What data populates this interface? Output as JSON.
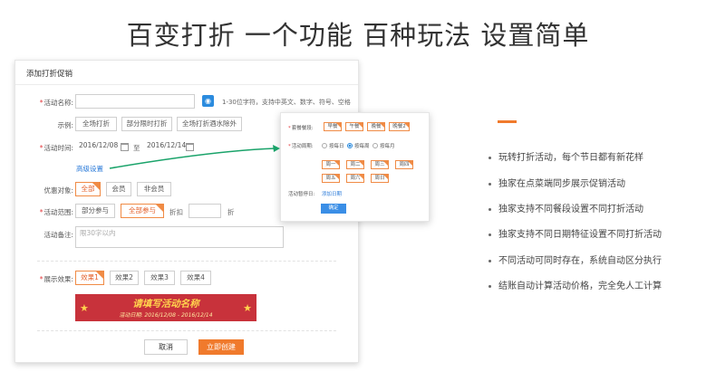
{
  "headline": "百变打折 一个功能 百种玩法 设置简单",
  "form": {
    "title": "添加打折促销",
    "activity_name": {
      "label": "活动名称:",
      "placeholder": "",
      "hint": "1-30位字符，支持中英文、数字、符号、空格"
    },
    "example": {
      "label": "示例:",
      "options": [
        "全场打折",
        "部分限时打折",
        "全场打折酒水除外"
      ]
    },
    "activity_time": {
      "label": "活动时间:",
      "start": "2016/12/08",
      "to": "至",
      "end": "2016/12/14",
      "advanced_link": "高级设置"
    },
    "audience": {
      "label": "优惠对象:",
      "options": [
        "全部",
        "会员",
        "非会员"
      ],
      "selected": "全部"
    },
    "scope": {
      "label": "活动范围:",
      "options": [
        "部分参与",
        "全部参与"
      ],
      "selected": "全部参与",
      "discount_label": "折扣",
      "discount_value": "",
      "discount_unit": "折"
    },
    "remark": {
      "label": "活动备注:",
      "placeholder": "限30字以内"
    },
    "display": {
      "label": "展示效果:",
      "options": [
        "效果1",
        "效果2",
        "效果3",
        "效果4"
      ],
      "selected": "效果1"
    },
    "banner": {
      "main": "请填写活动名称",
      "sub": "活动日期: 2016/12/08 - 2016/12/14"
    },
    "cancel_label": "取消",
    "create_label": "立即创建"
  },
  "popup": {
    "meal_label": "套餐餐段:",
    "meals": [
      "早餐",
      "午餐",
      "晚餐",
      "晚餐2"
    ],
    "cycle_label": "活动周期:",
    "cycles": [
      "按每日",
      "按每周",
      "按每月"
    ],
    "cycle_selected": "按每周",
    "weekdays": [
      "周一",
      "周二",
      "周三",
      "周四",
      "周五",
      "周六",
      "周日"
    ],
    "pause_label": "活动暂停日:",
    "pause_link": "添加日期",
    "ok_label": "确定"
  },
  "features": [
    "玩转打折活动，每个节日都有新花样",
    "独家在点菜端同步展示促销活动",
    "独家支持不同餐段设置不同打折活动",
    "独家支持不同日期特征设置不同打折活动",
    "不同活动可同时存在，系统自动区分执行",
    "结账自动计算活动价格，完全免人工计算"
  ],
  "colors": {
    "accent": "#f07a2c",
    "primary": "#3a8ee6",
    "arrow": "#1aa36a",
    "banner": "#c8323b"
  }
}
